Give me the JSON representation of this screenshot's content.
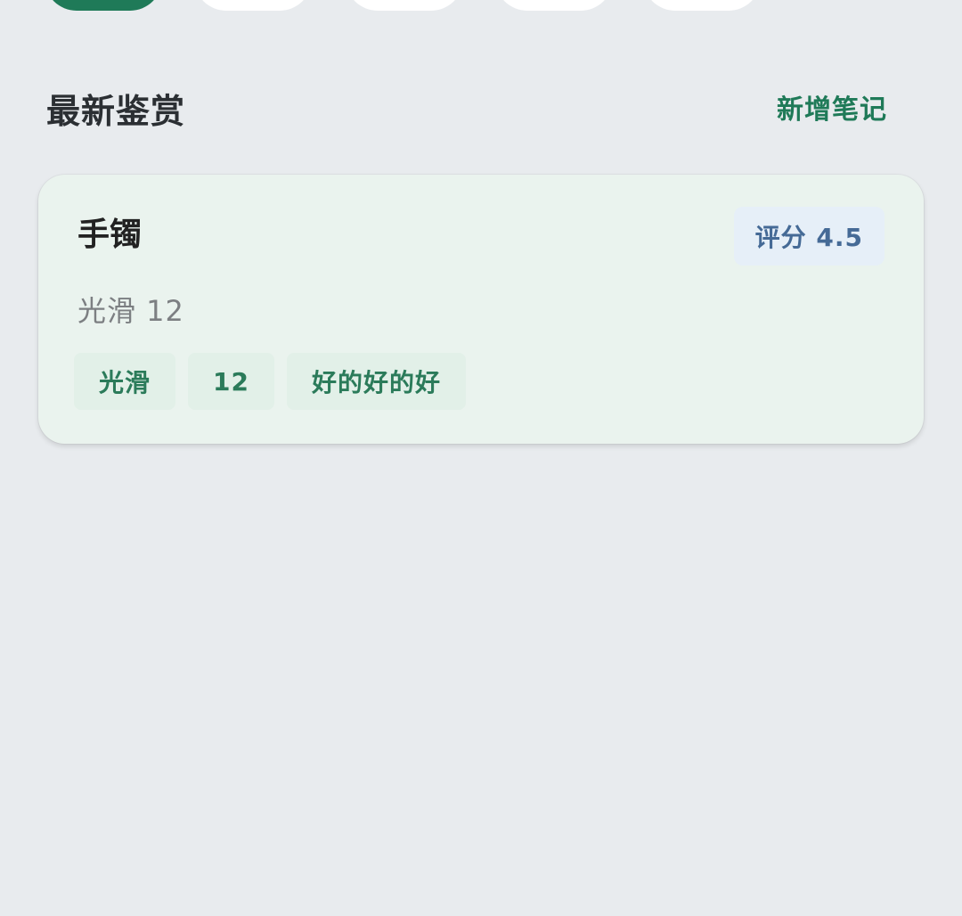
{
  "tabs": [
    {
      "label": "",
      "active": true
    },
    {
      "label": "",
      "active": false
    },
    {
      "label": "",
      "active": false
    },
    {
      "label": "",
      "active": false
    },
    {
      "label": "",
      "active": false
    }
  ],
  "section": {
    "title": "最新鉴赏",
    "add_note_label": "新增笔记"
  },
  "card": {
    "title": "手镯",
    "score_label": "评分 4.5",
    "subtitle": "光滑 12",
    "tags": [
      "光滑",
      "12",
      "好的好的好"
    ]
  },
  "colors": {
    "accent": "#1f7a58",
    "background": "#e8ebee",
    "card_background": "#eaf3ee",
    "score_text": "#456a96"
  }
}
